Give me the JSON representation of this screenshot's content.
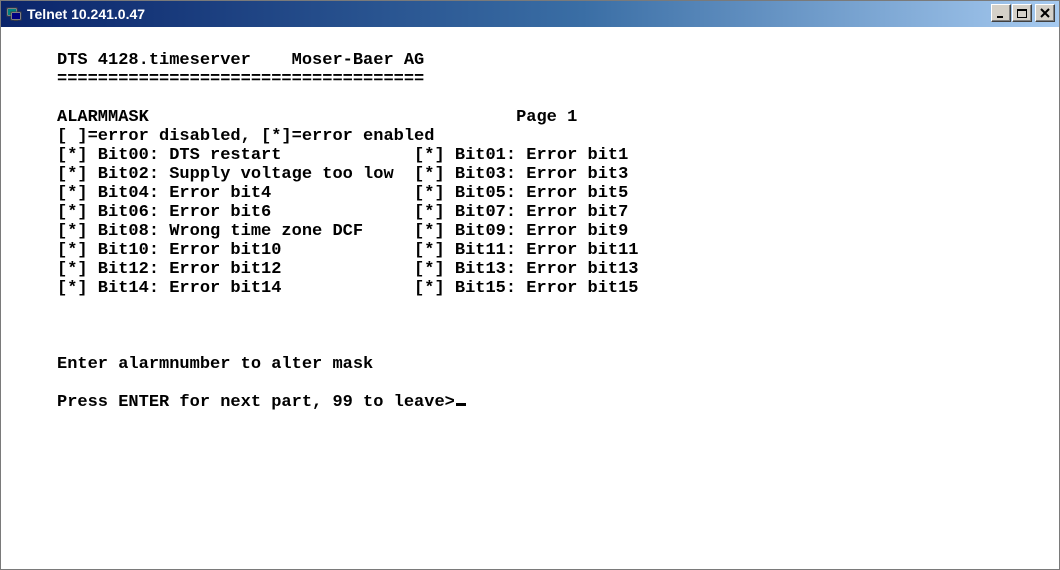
{
  "window": {
    "title": "Telnet 10.241.0.47",
    "icon": "telnet-terminal-icon",
    "controls": [
      "minimize",
      "maximize",
      "close"
    ]
  },
  "terminal": {
    "lines": [
      "DTS 4128.timeserver    Moser-Baer AG",
      "====================================",
      "",
      "ALARMMASK                                    Page 1",
      "[ ]=error disabled, [*]=error enabled",
      "[*] Bit00: DTS restart             [*] Bit01: Error bit1",
      "[*] Bit02: Supply voltage too low  [*] Bit03: Error bit3",
      "[*] Bit04: Error bit4              [*] Bit05: Error bit5",
      "[*] Bit06: Error bit6              [*] Bit07: Error bit7",
      "[*] Bit08: Wrong time zone DCF     [*] Bit09: Error bit9",
      "[*] Bit10: Error bit10             [*] Bit11: Error bit11",
      "[*] Bit12: Error bit12             [*] Bit13: Error bit13",
      "[*] Bit14: Error bit14             [*] Bit15: Error bit15",
      "",
      "",
      "",
      "Enter alarmnumber to alter mask",
      "",
      "Press ENTER for next part, 99 to leave>"
    ]
  },
  "colors": {
    "titlebar_start": "#0a246a",
    "titlebar_end": "#a6caf0",
    "terminal_bg": "#ffffff",
    "terminal_fg": "#000000"
  }
}
